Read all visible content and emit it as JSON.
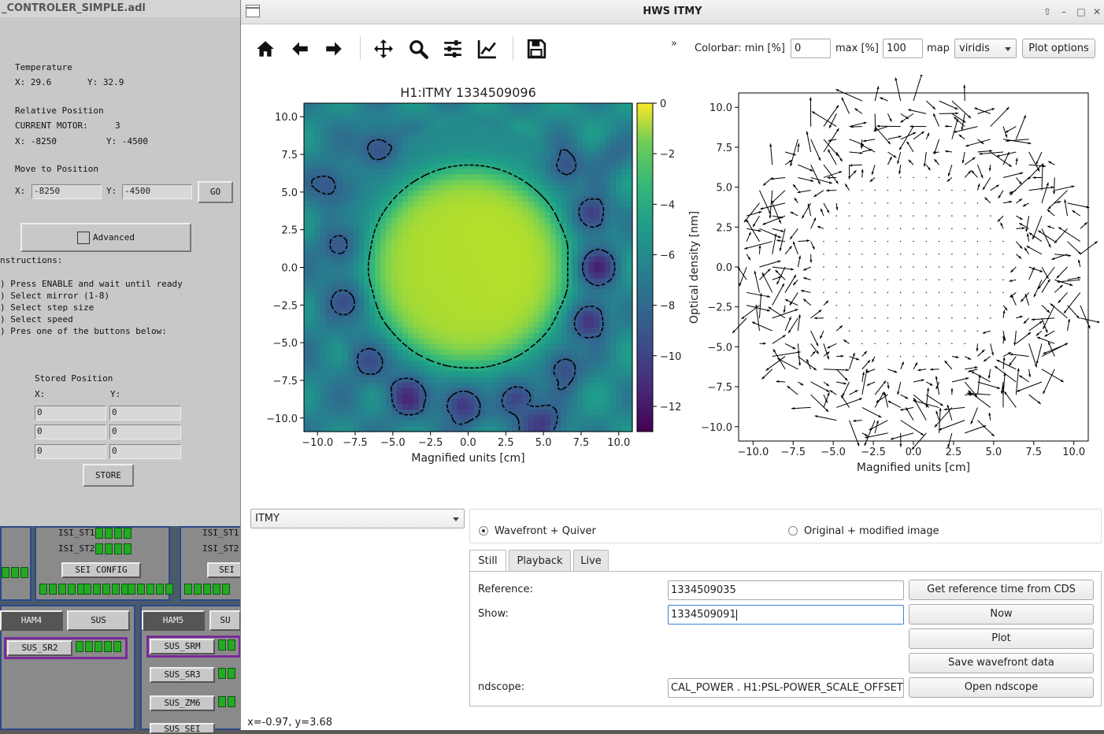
{
  "bg_window": {
    "title": "_CONTROLER_SIMPLE.adl",
    "temperature_heading": "Temperature",
    "temp_x": "X: 29.6",
    "temp_y": "Y: 32.9",
    "relpos_heading": "Relative Position",
    "current_motor_label": "CURRENT MOTOR:",
    "current_motor_value": "3",
    "relpos_x": "X: -8250",
    "relpos_y": "Y: -4500",
    "move_heading": "Move to Position",
    "move_x_label": "X:",
    "move_x_value": "-8250",
    "move_y_label": "Y:",
    "move_y_value": "-4500",
    "go_label": "GO",
    "advanced_label": "Advanced",
    "instructions_heading": "nstructions:",
    "instructions": [
      ") Press ENABLE and wait until ready",
      ") Select mirror (1-8)",
      ") Select step size",
      ") Select speed",
      ") Pres one of the buttons below:"
    ],
    "stored_heading": "Stored Position",
    "stored_x_label": "X:",
    "stored_y_label": "Y:",
    "stored_rows": [
      [
        "0",
        "0"
      ],
      [
        "0",
        "0"
      ],
      [
        "0",
        "0"
      ]
    ],
    "store_label": "STORE"
  },
  "bg_medm": {
    "isi_st1": "ISI_ST1",
    "isi_st2": "ISI_ST2",
    "sei_config": "SEI CONFIG",
    "sei_short": "SEI",
    "ham4": "HAM4",
    "sus": "SUS",
    "ham5": "HAM5",
    "sus_short": "SU",
    "sus_sr2": "SUS_SR2",
    "sus_srm": "SUS_SRM",
    "sus_sr3": "SUS_SR3",
    "sus_zm6": "SUS_ZM6",
    "sus_sei": "SUS_SEI"
  },
  "window": {
    "title": "HWS ITMY"
  },
  "toolbar": {
    "icons": [
      "home-icon",
      "back-arrow-icon",
      "forward-arrow-icon",
      "pan-icon",
      "zoom-icon",
      "configure-subplots-icon",
      "edit-curve-icon",
      "save-icon"
    ],
    "more": "»",
    "colorbar_min_label": "Colorbar: min [%]",
    "colorbar_min_value": "0",
    "colorbar_max_label": "max [%]",
    "colorbar_max_value": "100",
    "map_label": "map",
    "map_value": "viridis",
    "plot_options_label": "Plot options"
  },
  "chart_data": [
    {
      "type": "heatmap",
      "title": "H1:ITMY 1334509096",
      "xlabel": "Magnified units [cm]",
      "ylabel": "",
      "xlim": [
        -10.9,
        10.9
      ],
      "ylim": [
        -10.9,
        10.9
      ],
      "xticks": [
        "−10.0",
        "−7.5",
        "−5.0",
        "−2.5",
        "0.0",
        "2.5",
        "5.0",
        "7.5",
        "10.0"
      ],
      "yticks": [
        "10.0",
        "7.5",
        "5.0",
        "2.5",
        "0.0",
        "−2.5",
        "−5.0",
        "−7.5",
        "−10.0"
      ],
      "colormap": "viridis",
      "colorbar_label": "Optical density [nm]",
      "colorbar_ticks": [
        "0",
        "−2",
        "−4",
        "−6",
        "−8",
        "−10",
        "−12"
      ],
      "colorbar_range": [
        -13,
        0
      ],
      "contours": "dashed",
      "center_value": -1.5,
      "ring_value": -7,
      "wells": [
        {
          "x": 8.6,
          "y": 0.0,
          "v": -12.5
        },
        {
          "x": 8.0,
          "y": -3.6,
          "v": -11.5
        },
        {
          "x": 8.2,
          "y": 3.6,
          "v": -11
        },
        {
          "x": 6.5,
          "y": 6.8,
          "v": -10
        },
        {
          "x": 6.4,
          "y": -6.8,
          "v": -10
        },
        {
          "x": 3.2,
          "y": -8.8,
          "v": -10.5
        },
        {
          "x": -0.3,
          "y": -9.2,
          "v": -11
        },
        {
          "x": -4.0,
          "y": -8.5,
          "v": -11.5
        },
        {
          "x": -6.5,
          "y": -6.2,
          "v": -10
        },
        {
          "x": -8.2,
          "y": -2.3,
          "v": -10
        },
        {
          "x": -8.5,
          "y": 1.5,
          "v": -9.5
        },
        {
          "x": -9.0,
          "y": 5.5,
          "v": -10
        },
        {
          "x": -6.0,
          "y": 8.1,
          "v": -10.5
        },
        {
          "x": 5.0,
          "y": -10.5,
          "v": -11
        },
        {
          "x": 9.5,
          "y": 7.5,
          "v": -9
        }
      ]
    },
    {
      "type": "quiver",
      "title": "",
      "xlabel": "Magnified units [cm]",
      "ylabel": "",
      "xlim": [
        -10.9,
        10.9
      ],
      "ylim": [
        -10.9,
        10.9
      ],
      "xticks": [
        "−10.0",
        "−7.5",
        "−5.0",
        "−2.5",
        "0.0",
        "2.5",
        "5.0",
        "7.5",
        "10.0"
      ],
      "yticks": [
        "10.0",
        "7.5",
        "5.0",
        "2.5",
        "0.0",
        "−2.5",
        "−5.0",
        "−7.5",
        "−10.0"
      ],
      "grid_step": 0.8,
      "aperture_radius": 10.9,
      "inner_quiet_radius": 6.0
    }
  ],
  "camera_select": "ITMY",
  "display_mode": {
    "option1": "Wavefront + Quiver",
    "option2": "Original + modified image",
    "selected": "option1"
  },
  "tabs": [
    "Still",
    "Playback",
    "Live"
  ],
  "still": {
    "reference_label": "Reference:",
    "reference_value": "1334509035",
    "show_label": "Show:",
    "show_value": "1334509091",
    "ndscope_label": "ndscope:",
    "ndscope_value": "CAL_POWER . H1:PSL-POWER_SCALE_OFFSET",
    "get_ref_button": "Get reference time from CDS",
    "now_button": "Now",
    "plot_button": "Plot",
    "save_button": "Save wavefront data",
    "ndscope_button": "Open ndscope"
  },
  "status_text": "x=-0.97, y=3.68"
}
